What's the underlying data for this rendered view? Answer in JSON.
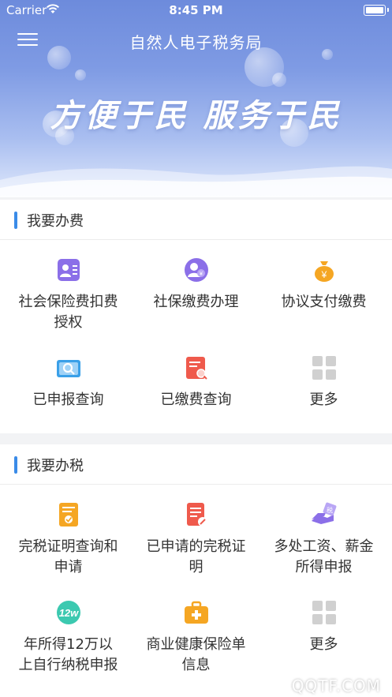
{
  "status_bar": {
    "carrier": "Carrier",
    "time": "8:45 PM"
  },
  "nav": {
    "title": "自然人电子税务局",
    "menu_icon": "hamburger-menu-icon"
  },
  "banner": {
    "slogan": "方便于民 服务于民"
  },
  "sections": [
    {
      "title": "我要办费",
      "items": [
        {
          "label": "社会保险费扣费授权",
          "icon": "id-card-icon",
          "color": "#8b6fe8"
        },
        {
          "label": "社保缴费办理",
          "icon": "yuan-person-icon",
          "color": "#8b6fe8"
        },
        {
          "label": "协议支付缴费",
          "icon": "money-bag-icon",
          "color": "#f5a623"
        },
        {
          "label": "已申报查询",
          "icon": "search-folder-icon",
          "color": "#3aa0e8"
        },
        {
          "label": "已缴费查询",
          "icon": "receipt-search-icon",
          "color": "#ef5a4c"
        },
        {
          "label": "更多",
          "icon": "grid-more-icon",
          "color": "#c8c8c8"
        }
      ]
    },
    {
      "title": "我要办税",
      "items": [
        {
          "label": "完税证明查询和申请",
          "icon": "certificate-icon",
          "color": "#f5a623"
        },
        {
          "label": "已申请的完税证明",
          "icon": "document-edit-icon",
          "color": "#ef5a4c"
        },
        {
          "label": "多处工资、薪金所得申报",
          "icon": "hand-tax-icon",
          "color": "#8b6fe8"
        },
        {
          "label": "年所得12万以上自行纳税申报",
          "icon": "12w-badge-icon",
          "color": "#3cc9b0"
        },
        {
          "label": "商业健康保险单信息",
          "icon": "medical-kit-icon",
          "color": "#f5a623"
        },
        {
          "label": "更多",
          "icon": "grid-more-icon",
          "color": "#c8c8c8"
        }
      ]
    }
  ],
  "watermark": "QQTF.COM"
}
